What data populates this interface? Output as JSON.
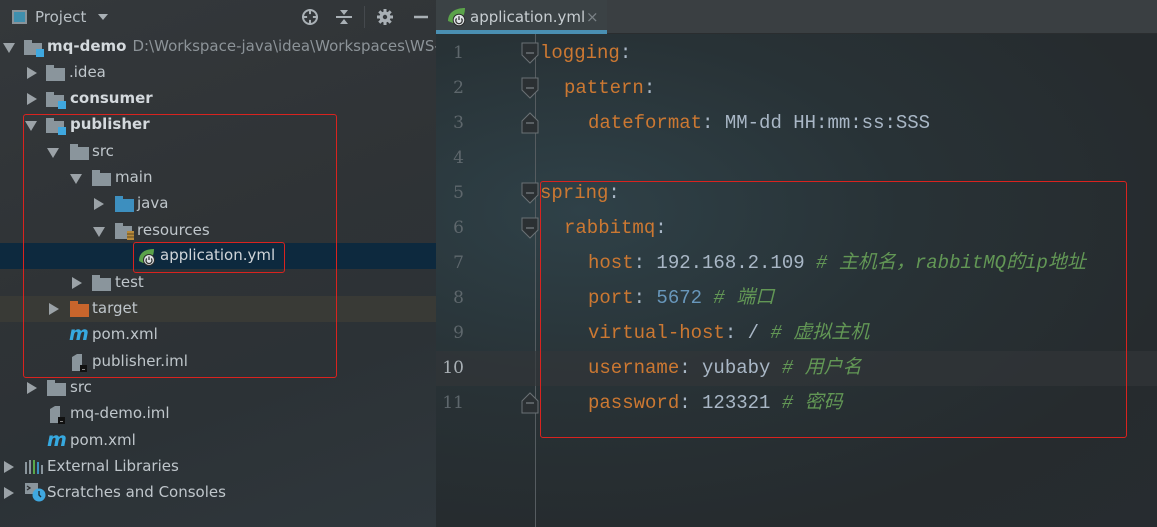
{
  "project_panel": {
    "title": "Project",
    "toolbar_icons": [
      "locate-icon",
      "collapse-all-icon",
      "settings-icon",
      "hide-icon"
    ],
    "tree": [
      {
        "label": "mq-demo",
        "path": "D:\\Workspace-java\\idea\\Workspaces\\WS-I",
        "type": "module",
        "expanded": true,
        "bold": true
      },
      {
        "label": ".idea",
        "type": "folder",
        "expanded": false
      },
      {
        "label": "consumer",
        "type": "module",
        "expanded": false,
        "bold": true
      },
      {
        "label": "publisher",
        "type": "module",
        "expanded": true,
        "bold": true
      },
      {
        "label": "src",
        "type": "folder",
        "expanded": true
      },
      {
        "label": "main",
        "type": "folder",
        "expanded": true
      },
      {
        "label": "java",
        "type": "source-folder",
        "expanded": false
      },
      {
        "label": "resources",
        "type": "resources-folder",
        "expanded": true
      },
      {
        "label": "application.yml",
        "type": "spring-yml",
        "selected": true
      },
      {
        "label": "test",
        "type": "folder",
        "expanded": false
      },
      {
        "label": "target",
        "type": "excluded-folder",
        "expanded": false
      },
      {
        "label": "pom.xml",
        "type": "maven"
      },
      {
        "label": "publisher.iml",
        "type": "iml"
      },
      {
        "label": "src",
        "type": "folder",
        "expanded": false
      },
      {
        "label": "mq-demo.iml",
        "type": "iml"
      },
      {
        "label": "pom.xml",
        "type": "maven"
      },
      {
        "label": "External Libraries",
        "type": "libraries",
        "expanded": false
      },
      {
        "label": "Scratches and Consoles",
        "type": "scratches",
        "expanded": false
      }
    ]
  },
  "editor": {
    "tab": {
      "label": "application.yml",
      "close": "×"
    },
    "current_line": 10,
    "lines": [
      {
        "num": "1",
        "key": "logging",
        "sep": ":",
        "value": "",
        "comment": ""
      },
      {
        "num": "2",
        "key": "pattern",
        "sep": ":",
        "value": "",
        "comment": ""
      },
      {
        "num": "3",
        "key": "dateformat",
        "sep": ":",
        "value": " MM-dd HH:mm:ss:SSS",
        "comment": ""
      },
      {
        "num": "4",
        "key": "",
        "sep": "",
        "value": "",
        "comment": ""
      },
      {
        "num": "5",
        "key": "spring",
        "sep": ":",
        "value": "",
        "comment": ""
      },
      {
        "num": "6",
        "key": "rabbitmq",
        "sep": ":",
        "value": "",
        "comment": ""
      },
      {
        "num": "7",
        "key": "host",
        "sep": ":",
        "value": " 192.168.2.109",
        "comment": " # 主机名，rabbitMQ的ip地址"
      },
      {
        "num": "8",
        "key": "port",
        "sep": ":",
        "value": " 5672",
        "comment": " # 端口"
      },
      {
        "num": "9",
        "key": "virtual-host",
        "sep": ":",
        "value": " /",
        "comment": " # 虚拟主机"
      },
      {
        "num": "10",
        "key": "username",
        "sep": ":",
        "value": " yubaby",
        "comment": " # 用户名"
      },
      {
        "num": "11",
        "key": "password",
        "sep": ":",
        "value": " 123321",
        "comment": " # 密码"
      }
    ]
  },
  "colors": {
    "key": "#cc7832",
    "comment": "#629755",
    "number": "#6897bb",
    "text": "#a9b7c6",
    "highlight_box": "#d9231f",
    "tab_underline": "#4a8fb2",
    "selected_row": "#0d293e"
  }
}
